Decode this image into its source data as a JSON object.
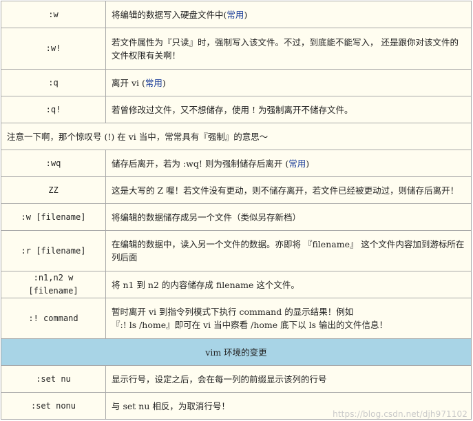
{
  "rows": [
    {
      "cmd": ":w",
      "desc": "将编辑的数据写入硬盘文件中(",
      "hl": "常用",
      "tail": ")"
    },
    {
      "cmd": ":w!",
      "desc": "若文件属性为『只读』时，强制写入该文件。不过，到底能不能写入， 还是跟你对该文件的文件权限有关啊！"
    },
    {
      "cmd": ":q",
      "desc": "离开 vi (",
      "hl": "常用",
      "tail": ")"
    },
    {
      "cmd": ":q!",
      "desc": "若曾修改过文件，又不想储存，使用 ! 为强制离开不储存文件。"
    },
    {
      "note": "注意一下啊，那个惊叹号 (!) 在 vi 当中，常常具有『强制』的意思～"
    },
    {
      "cmd": ":wq",
      "desc": "储存后离开，若为 :wq! 则为强制储存后离开 (",
      "hl": "常用",
      "tail": ")"
    },
    {
      "cmd": "ZZ",
      "desc": "这是大写的 Z 喔！若文件没有更动，则不储存离开，若文件已经被更动过，则储存后离开！"
    },
    {
      "cmd": ":w [filename]",
      "desc": "将编辑的数据储存成另一个文件（类似另存新档）"
    },
    {
      "cmd": ":r [filename]",
      "desc": "在编辑的数据中，读入另一个文件的数据。亦即将 『filename』 这个文件内容加到游标所在列后面"
    },
    {
      "cmd": ":n1,n2 w [filename]",
      "desc": "将 n1 到 n2 的内容储存成 filename 这个文件。"
    },
    {
      "cmd": ":! command",
      "desc": "暂时离开 vi 到指令列模式下执行 command 的显示结果！例如",
      "desc2": "『:! ls /home』即可在 vi 当中察看 /home 底下以 ls 输出的文件信息！"
    },
    {
      "section": "vim 环境的变更"
    },
    {
      "cmd": ":set nu",
      "desc": "显示行号，设定之后，会在每一列的前缀显示该列的行号"
    },
    {
      "cmd": ":set nonu",
      "desc": "与 set nu 相反，为取消行号！"
    }
  ],
  "watermark": "https://blog.csdn.net/djh971102",
  "colors": {
    "section_bg": "#a8d4e6",
    "table_bg": "#fffdf0",
    "highlight": "#1d3f9a",
    "border": "#a8a8a8"
  }
}
